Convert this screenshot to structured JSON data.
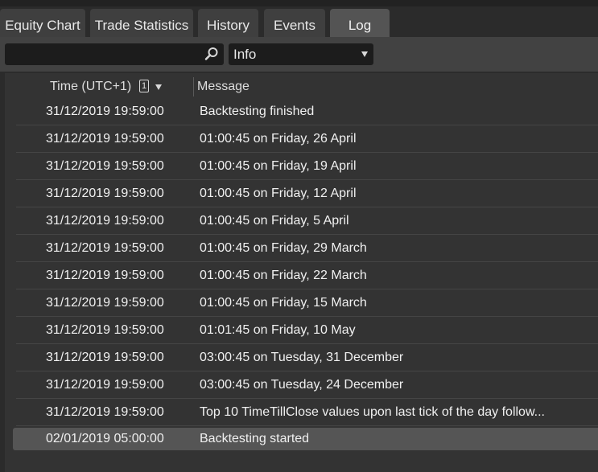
{
  "tabs": [
    {
      "label": "Equity Chart",
      "active": false
    },
    {
      "label": "Trade Statistics",
      "active": false
    },
    {
      "label": "History",
      "active": false
    },
    {
      "label": "Events",
      "active": false
    },
    {
      "label": "Log",
      "active": true
    }
  ],
  "toolbar": {
    "search_value": "",
    "search_icon": "search-icon",
    "level_filter": "Info"
  },
  "table": {
    "columns": {
      "time": "Time (UTC+1)",
      "sort_index": "1",
      "message": "Message"
    },
    "rows": [
      {
        "time": "31/12/2019 19:59:00",
        "message": "Backtesting finished"
      },
      {
        "time": "31/12/2019 19:59:00",
        "message": "01:00:45 on Friday, 26 April"
      },
      {
        "time": "31/12/2019 19:59:00",
        "message": "01:00:45 on Friday, 19 April"
      },
      {
        "time": "31/12/2019 19:59:00",
        "message": "01:00:45 on Friday, 12 April"
      },
      {
        "time": "31/12/2019 19:59:00",
        "message": "01:00:45 on Friday, 5 April"
      },
      {
        "time": "31/12/2019 19:59:00",
        "message": "01:00:45 on Friday, 29 March"
      },
      {
        "time": "31/12/2019 19:59:00",
        "message": "01:00:45 on Friday, 22 March"
      },
      {
        "time": "31/12/2019 19:59:00",
        "message": "01:00:45 on Friday, 15 March"
      },
      {
        "time": "31/12/2019 19:59:00",
        "message": "01:01:45 on Friday, 10 May"
      },
      {
        "time": "31/12/2019 19:59:00",
        "message": "03:00:45 on Tuesday, 31 December"
      },
      {
        "time": "31/12/2019 19:59:00",
        "message": "03:00:45 on Tuesday, 24 December"
      },
      {
        "time": "31/12/2019 19:59:00",
        "message": "Top 10 TimeTillClose values upon last tick of the day follow..."
      },
      {
        "time": "02/01/2019 05:00:00",
        "message": "Backtesting started",
        "selected": true
      }
    ]
  },
  "colors": {
    "background": "#2b2b2b",
    "tab": "#3f3f3f",
    "tab_active": "#545454",
    "toolbar": "#424242",
    "input": "#1c1c1c",
    "selected_row": "#555555"
  }
}
